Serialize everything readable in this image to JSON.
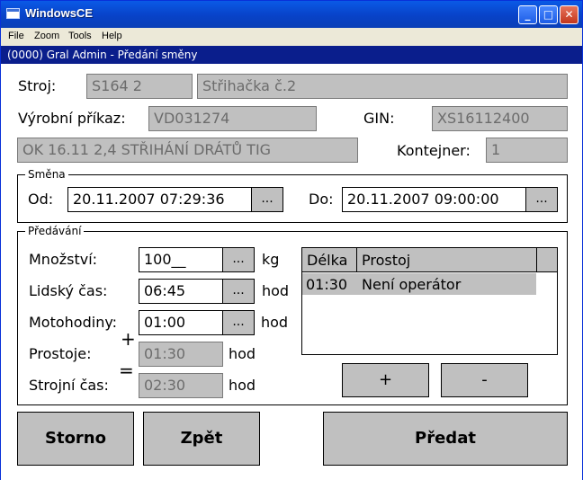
{
  "window": {
    "title": "WindowsCE"
  },
  "menu": [
    "File",
    "Zoom",
    "Tools",
    "Help"
  ],
  "header": "(0000) Gral Admin - Předání směny",
  "machine": {
    "label": "Stroj:",
    "code": "S164 2",
    "name": "Střihačka č.2"
  },
  "order": {
    "label": "Výrobní příkaz:",
    "value": "VD031274",
    "gin_label": "GIN:",
    "gin_value": "XS16112400"
  },
  "description": "OK 16.11 2,4 STŘIHÁNÍ DRÁTŮ TIG",
  "container": {
    "label": "Kontejner:",
    "value": "1"
  },
  "shift": {
    "title": "Směna",
    "from_label": "Od:",
    "from_value": "20.11.2007 07:29:36",
    "to_label": "Do:",
    "to_value": "20.11.2007 09:00:00",
    "picker_label": "..."
  },
  "handover": {
    "title": "Předávání",
    "quantity_label": "Množství:",
    "quantity_value": "100__",
    "quantity_unit": "kg",
    "human_time_label": "Lidský čas:",
    "human_time_value": "06:45",
    "human_time_unit": "hod",
    "motor_hours_label": "Motohodiny:",
    "motor_hours_value": "01:00",
    "motor_hours_unit": "hod",
    "downtime_label": "Prostoje:",
    "downtime_value": "01:30",
    "downtime_unit": "hod",
    "machine_time_label": "Strojní čas:",
    "machine_time_value": "02:30",
    "machine_time_unit": "hod",
    "plus_sign": "+",
    "equals_sign": "=",
    "picker_label": "..."
  },
  "downtime_list": {
    "columns": [
      "Délka",
      "Prostoj"
    ],
    "rows": [
      {
        "length": "01:30",
        "reason": "Není operátor"
      }
    ],
    "add_label": "+",
    "remove_label": "-"
  },
  "buttons": {
    "cancel": "Storno",
    "back": "Zpět",
    "submit": "Předat"
  },
  "titlebar_buttons": {
    "minimize": "_",
    "maximize": "□",
    "close": "✕"
  }
}
